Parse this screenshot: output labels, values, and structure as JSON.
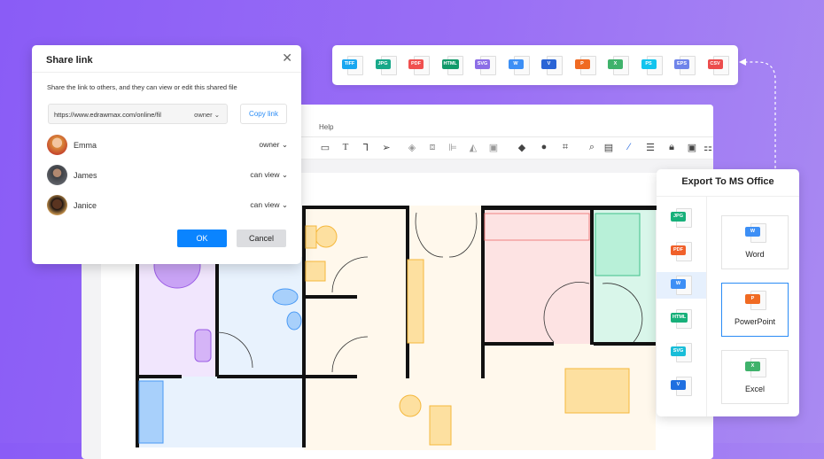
{
  "editor": {
    "menu": {
      "help": "Help"
    }
  },
  "share_dialog": {
    "title": "Share link",
    "description": "Share the link to others, and they can view or edit this shared file",
    "link_url": "https://www.edrawmax.com/online/fil",
    "link_permission": "owner",
    "copy_label": "Copy link",
    "users": [
      {
        "name": "Emma",
        "role": "owner",
        "avatar_color": "#d9893a"
      },
      {
        "name": "James",
        "role": "can view",
        "avatar_color": "#3d3f44"
      },
      {
        "name": "Janice",
        "role": "can view",
        "avatar_color": "#c98a3c"
      }
    ],
    "ok_label": "OK",
    "cancel_label": "Cancel"
  },
  "formats": [
    {
      "label": "TIFF",
      "color": "#1aa7f0"
    },
    {
      "label": "JPG",
      "color": "#17a889"
    },
    {
      "label": "PDF",
      "color": "#f0504f"
    },
    {
      "label": "HTML",
      "color": "#129a6a"
    },
    {
      "label": "SVG",
      "color": "#8c6ee6"
    },
    {
      "label": "W",
      "color": "#3d8ff5"
    },
    {
      "label": "V",
      "color": "#2a64d6"
    },
    {
      "label": "P",
      "color": "#f06a22"
    },
    {
      "label": "X",
      "color": "#3fb26b"
    },
    {
      "label": "PS",
      "color": "#12c4ee"
    },
    {
      "label": "EPS",
      "color": "#6f84ea"
    },
    {
      "label": "CSV",
      "color": "#ec4c4c"
    }
  ],
  "export_panel": {
    "title": "Export To MS Office",
    "side_formats": [
      {
        "label": "JPG",
        "color": "#17b07a"
      },
      {
        "label": "PDF",
        "color": "#f0602a"
      },
      {
        "label": "W",
        "color": "#3d8ff5"
      },
      {
        "label": "HTML",
        "color": "#17b07a"
      },
      {
        "label": "SVG",
        "color": "#19bdd8"
      },
      {
        "label": "V",
        "color": "#1f6fe0"
      }
    ],
    "options": [
      {
        "label": "Word",
        "icon": "W",
        "color": "#3d8ff5"
      },
      {
        "label": "PowerPoint",
        "icon": "P",
        "color": "#f06a22"
      },
      {
        "label": "Excel",
        "icon": "X",
        "color": "#3fb26b"
      }
    ],
    "selected": "PowerPoint"
  }
}
